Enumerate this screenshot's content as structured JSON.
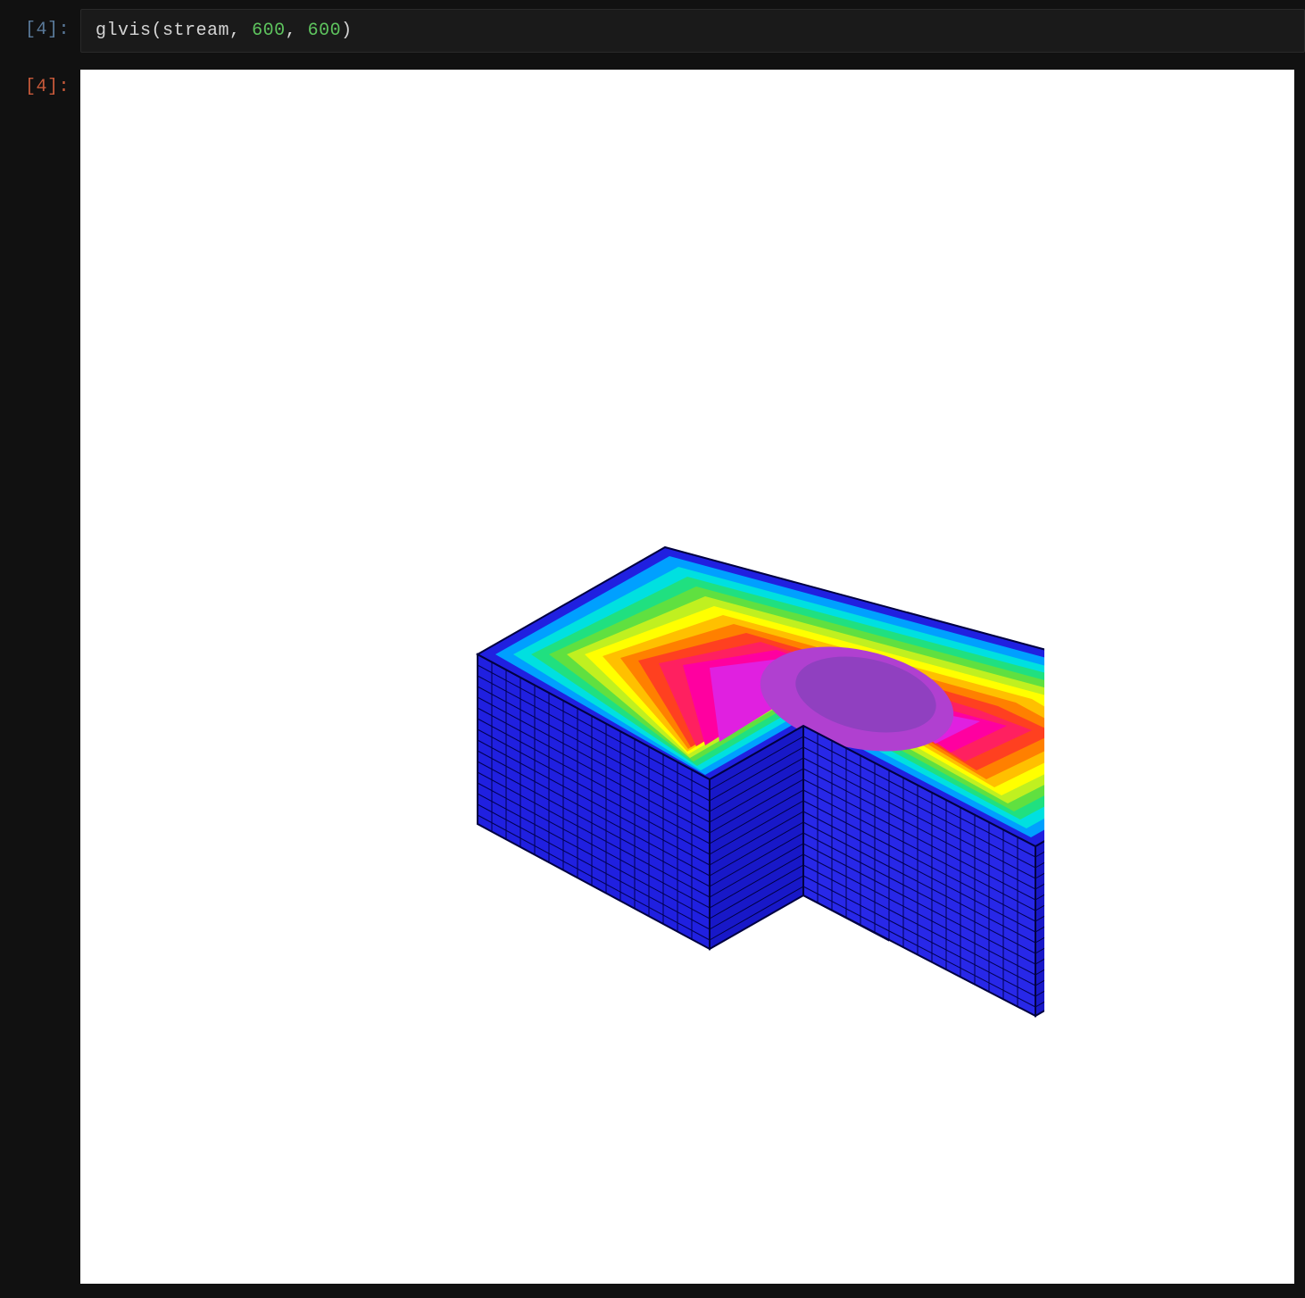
{
  "input_cell": {
    "prompt_number": "4",
    "prompt_prefix": "[",
    "prompt_suffix": "]:",
    "code": {
      "function_name": "glvis",
      "arg1": "stream",
      "arg2": "600",
      "arg3": "600"
    }
  },
  "output_cell": {
    "prompt_number": "4",
    "prompt_prefix": "[",
    "prompt_suffix": "]:"
  },
  "visualization": {
    "type": "3d-mesh-fem",
    "description": "L-shaped 3D domain with rainbow colormap solution field on top surface and blue mesh grid on sides",
    "grid_divisions": 16,
    "colormap": "rainbow",
    "colors": {
      "mesh_blue": "#2020e0",
      "mesh_line": "#000060",
      "blue": "#0040ff",
      "cyan": "#00e0e0",
      "green": "#40e040",
      "yellow": "#ffff00",
      "orange": "#ff8000",
      "red": "#ff2020",
      "magenta": "#ff00c0",
      "purple": "#a040c0"
    }
  }
}
